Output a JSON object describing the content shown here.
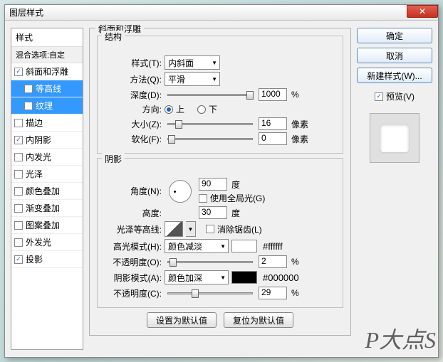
{
  "title": "图层样式",
  "close": "✕",
  "styles": {
    "header": "样式",
    "blend": "混合选项:自定",
    "items": [
      {
        "label": "斜面和浮雕",
        "checked": true,
        "selected": false
      },
      {
        "label": "等高线",
        "checked": false,
        "selected": true,
        "sub": true
      },
      {
        "label": "纹理",
        "checked": false,
        "selected": true,
        "sub": true
      },
      {
        "label": "描边",
        "checked": false
      },
      {
        "label": "内阴影",
        "checked": true
      },
      {
        "label": "内发光",
        "checked": false
      },
      {
        "label": "光泽",
        "checked": false
      },
      {
        "label": "颜色叠加",
        "checked": false
      },
      {
        "label": "渐变叠加",
        "checked": false
      },
      {
        "label": "图案叠加",
        "checked": false
      },
      {
        "label": "外发光",
        "checked": false
      },
      {
        "label": "投影",
        "checked": true
      }
    ]
  },
  "bevel": {
    "section_title": "斜面和浮雕",
    "structure": {
      "legend": "结构",
      "style_label": "样式(T):",
      "style_value": "内斜面",
      "technique_label": "方法(Q):",
      "technique_value": "平滑",
      "depth_label": "深度(D):",
      "depth_value": "1000",
      "depth_unit": "%",
      "direction_label": "方向:",
      "up": "上",
      "down": "下",
      "size_label": "大小(Z):",
      "size_value": "16",
      "size_unit": "像素",
      "soften_label": "软化(F):",
      "soften_value": "0",
      "soften_unit": "像素"
    },
    "shading": {
      "legend": "阴影",
      "angle_label": "角度(N):",
      "angle_value": "90",
      "angle_unit": "度",
      "global_label": "使用全局光(G)",
      "altitude_label": "高度:",
      "altitude_value": "30",
      "altitude_unit": "度",
      "gloss_label": "光泽等高线:",
      "antialias_label": "消除锯齿(L)",
      "highlight_mode_label": "高光模式(H):",
      "highlight_mode_value": "颜色减淡",
      "highlight_hex": "#ffffff",
      "highlight_opacity_label": "不透明度(O):",
      "highlight_opacity_value": "2",
      "opacity_unit": "%",
      "shadow_mode_label": "阴影模式(A):",
      "shadow_mode_value": "颜色加深",
      "shadow_hex": "#000000",
      "shadow_opacity_label": "不透明度(C):",
      "shadow_opacity_value": "29"
    },
    "defaults": {
      "set": "设置为默认值",
      "reset": "复位为默认值"
    }
  },
  "buttons": {
    "ok": "确定",
    "cancel": "取消",
    "new_style": "新建样式(W)...",
    "preview": "预览(V)"
  },
  "watermark": "P大点S"
}
